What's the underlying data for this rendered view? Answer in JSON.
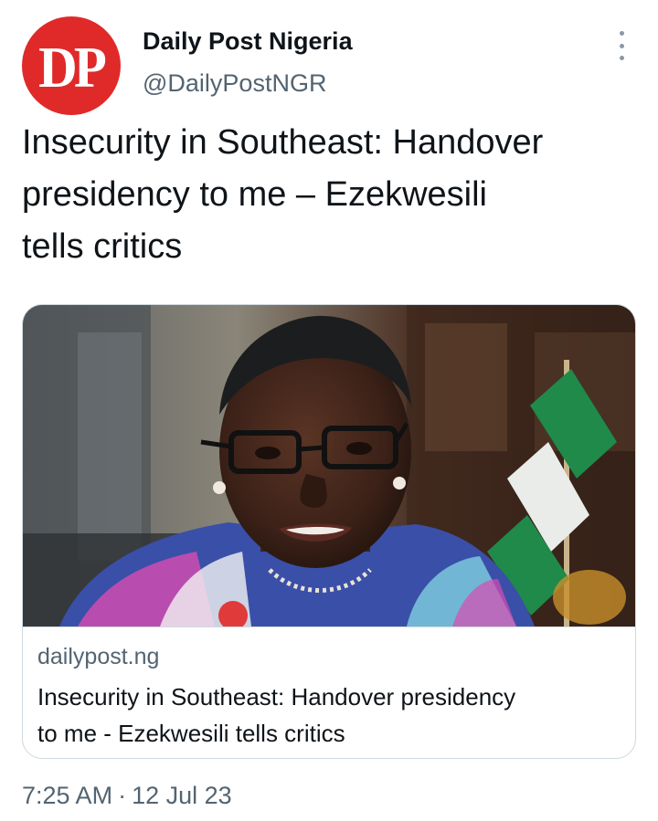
{
  "author": {
    "avatar_text": "DP",
    "name": "Daily Post Nigeria",
    "handle": "@DailyPostNGR"
  },
  "tweet": {
    "text_line1": "Insecurity in Southeast: Handover",
    "text_line2": "presidency to me – Ezekwesili",
    "text_line3": "tells critics"
  },
  "card": {
    "image_icon": "photo-icon",
    "domain": "dailypost.ng",
    "title_line1": "Insecurity in Southeast: Handover presidency",
    "title_line2": "to me - Ezekwesili tells critics"
  },
  "meta": {
    "time": "7:25 AM",
    "separator": "·",
    "date": "12 Jul 23"
  },
  "colors": {
    "avatar_bg": "#e02a2a",
    "text_primary": "#0f1419",
    "text_secondary": "#536471",
    "border": "#cfd9de"
  }
}
